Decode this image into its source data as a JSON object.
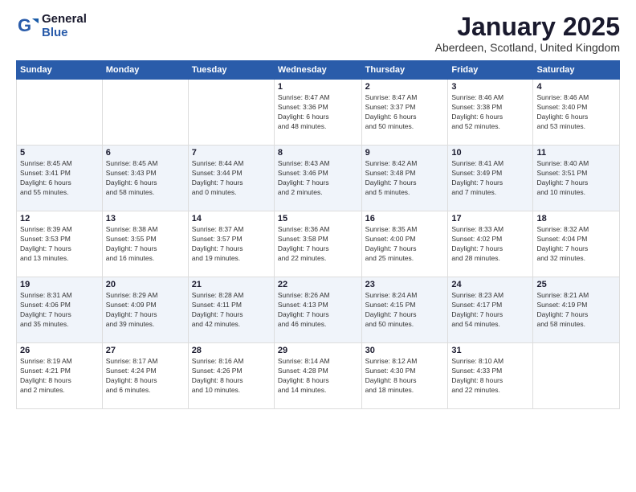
{
  "logo": {
    "general": "General",
    "blue": "Blue"
  },
  "title": "January 2025",
  "location": "Aberdeen, Scotland, United Kingdom",
  "weekdays": [
    "Sunday",
    "Monday",
    "Tuesday",
    "Wednesday",
    "Thursday",
    "Friday",
    "Saturday"
  ],
  "weeks": [
    [
      {
        "day": "",
        "info": ""
      },
      {
        "day": "",
        "info": ""
      },
      {
        "day": "",
        "info": ""
      },
      {
        "day": "1",
        "info": "Sunrise: 8:47 AM\nSunset: 3:36 PM\nDaylight: 6 hours\nand 48 minutes."
      },
      {
        "day": "2",
        "info": "Sunrise: 8:47 AM\nSunset: 3:37 PM\nDaylight: 6 hours\nand 50 minutes."
      },
      {
        "day": "3",
        "info": "Sunrise: 8:46 AM\nSunset: 3:38 PM\nDaylight: 6 hours\nand 52 minutes."
      },
      {
        "day": "4",
        "info": "Sunrise: 8:46 AM\nSunset: 3:40 PM\nDaylight: 6 hours\nand 53 minutes."
      }
    ],
    [
      {
        "day": "5",
        "info": "Sunrise: 8:45 AM\nSunset: 3:41 PM\nDaylight: 6 hours\nand 55 minutes."
      },
      {
        "day": "6",
        "info": "Sunrise: 8:45 AM\nSunset: 3:43 PM\nDaylight: 6 hours\nand 58 minutes."
      },
      {
        "day": "7",
        "info": "Sunrise: 8:44 AM\nSunset: 3:44 PM\nDaylight: 7 hours\nand 0 minutes."
      },
      {
        "day": "8",
        "info": "Sunrise: 8:43 AM\nSunset: 3:46 PM\nDaylight: 7 hours\nand 2 minutes."
      },
      {
        "day": "9",
        "info": "Sunrise: 8:42 AM\nSunset: 3:48 PM\nDaylight: 7 hours\nand 5 minutes."
      },
      {
        "day": "10",
        "info": "Sunrise: 8:41 AM\nSunset: 3:49 PM\nDaylight: 7 hours\nand 7 minutes."
      },
      {
        "day": "11",
        "info": "Sunrise: 8:40 AM\nSunset: 3:51 PM\nDaylight: 7 hours\nand 10 minutes."
      }
    ],
    [
      {
        "day": "12",
        "info": "Sunrise: 8:39 AM\nSunset: 3:53 PM\nDaylight: 7 hours\nand 13 minutes."
      },
      {
        "day": "13",
        "info": "Sunrise: 8:38 AM\nSunset: 3:55 PM\nDaylight: 7 hours\nand 16 minutes."
      },
      {
        "day": "14",
        "info": "Sunrise: 8:37 AM\nSunset: 3:57 PM\nDaylight: 7 hours\nand 19 minutes."
      },
      {
        "day": "15",
        "info": "Sunrise: 8:36 AM\nSunset: 3:58 PM\nDaylight: 7 hours\nand 22 minutes."
      },
      {
        "day": "16",
        "info": "Sunrise: 8:35 AM\nSunset: 4:00 PM\nDaylight: 7 hours\nand 25 minutes."
      },
      {
        "day": "17",
        "info": "Sunrise: 8:33 AM\nSunset: 4:02 PM\nDaylight: 7 hours\nand 28 minutes."
      },
      {
        "day": "18",
        "info": "Sunrise: 8:32 AM\nSunset: 4:04 PM\nDaylight: 7 hours\nand 32 minutes."
      }
    ],
    [
      {
        "day": "19",
        "info": "Sunrise: 8:31 AM\nSunset: 4:06 PM\nDaylight: 7 hours\nand 35 minutes."
      },
      {
        "day": "20",
        "info": "Sunrise: 8:29 AM\nSunset: 4:09 PM\nDaylight: 7 hours\nand 39 minutes."
      },
      {
        "day": "21",
        "info": "Sunrise: 8:28 AM\nSunset: 4:11 PM\nDaylight: 7 hours\nand 42 minutes."
      },
      {
        "day": "22",
        "info": "Sunrise: 8:26 AM\nSunset: 4:13 PM\nDaylight: 7 hours\nand 46 minutes."
      },
      {
        "day": "23",
        "info": "Sunrise: 8:24 AM\nSunset: 4:15 PM\nDaylight: 7 hours\nand 50 minutes."
      },
      {
        "day": "24",
        "info": "Sunrise: 8:23 AM\nSunset: 4:17 PM\nDaylight: 7 hours\nand 54 minutes."
      },
      {
        "day": "25",
        "info": "Sunrise: 8:21 AM\nSunset: 4:19 PM\nDaylight: 7 hours\nand 58 minutes."
      }
    ],
    [
      {
        "day": "26",
        "info": "Sunrise: 8:19 AM\nSunset: 4:21 PM\nDaylight: 8 hours\nand 2 minutes."
      },
      {
        "day": "27",
        "info": "Sunrise: 8:17 AM\nSunset: 4:24 PM\nDaylight: 8 hours\nand 6 minutes."
      },
      {
        "day": "28",
        "info": "Sunrise: 8:16 AM\nSunset: 4:26 PM\nDaylight: 8 hours\nand 10 minutes."
      },
      {
        "day": "29",
        "info": "Sunrise: 8:14 AM\nSunset: 4:28 PM\nDaylight: 8 hours\nand 14 minutes."
      },
      {
        "day": "30",
        "info": "Sunrise: 8:12 AM\nSunset: 4:30 PM\nDaylight: 8 hours\nand 18 minutes."
      },
      {
        "day": "31",
        "info": "Sunrise: 8:10 AM\nSunset: 4:33 PM\nDaylight: 8 hours\nand 22 minutes."
      },
      {
        "day": "",
        "info": ""
      }
    ]
  ]
}
